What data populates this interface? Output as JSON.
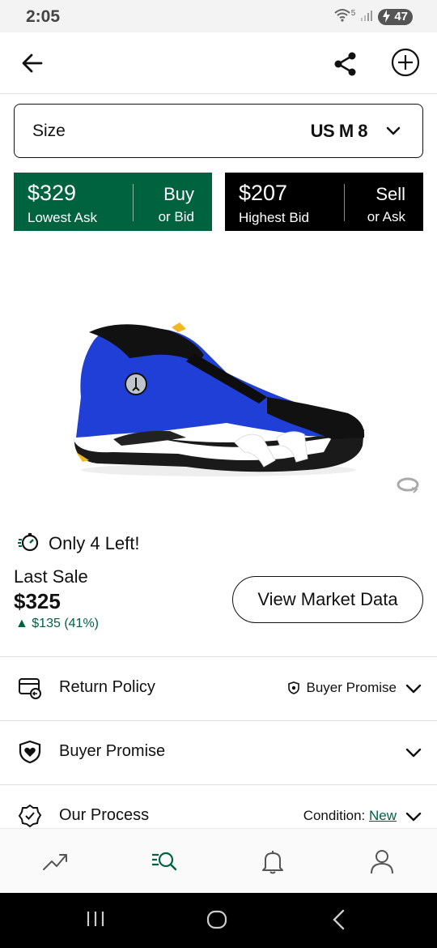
{
  "status_bar": {
    "time": "2:05",
    "battery": "47",
    "wifi_badge": "5"
  },
  "header": {
    "back_icon": "arrow-left-icon",
    "share_icon": "share-icon",
    "add_icon": "plus-circle-icon"
  },
  "size_selector": {
    "label": "Size",
    "value": "US M 8"
  },
  "buy": {
    "price": "$329",
    "sub": "Lowest Ask",
    "action": "Buy",
    "action_sub": "or Bid",
    "color": "#006340"
  },
  "sell": {
    "price": "$207",
    "sub": "Highest Bid",
    "action": "Sell",
    "action_sub": "or Ask",
    "color": "#000000"
  },
  "stock": {
    "text": "Only 4 Left!"
  },
  "last_sale": {
    "label": "Last Sale",
    "price": "$325",
    "change": "▲ $135 (41%)"
  },
  "market_button": {
    "label": "View Market Data"
  },
  "rows": [
    {
      "label": "Return Policy",
      "right_text": "Buyer Promise",
      "icon": "return-card-icon"
    },
    {
      "label": "Buyer Promise",
      "icon": "shield-heart-icon"
    },
    {
      "label": "Our Process",
      "right_prefix": "Condition: ",
      "right_link": "New",
      "icon": "verified-badge-icon"
    }
  ],
  "bottom_nav": [
    "trending-icon",
    "search-icon",
    "bell-icon",
    "profile-icon"
  ],
  "accent_color": "#006340"
}
